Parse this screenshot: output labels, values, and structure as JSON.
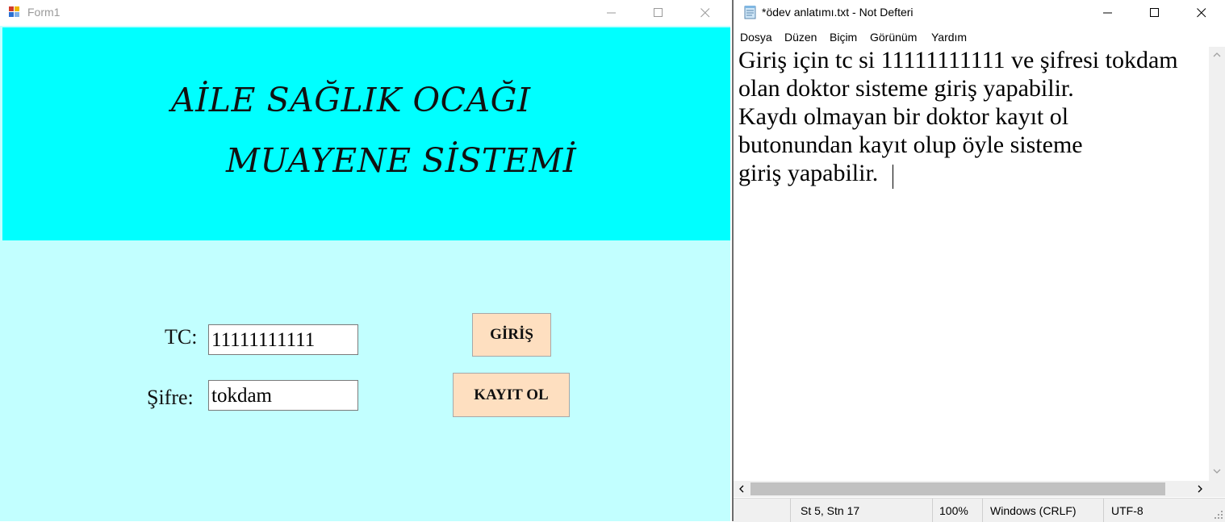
{
  "form1": {
    "title": "Form1",
    "heading_line1": "AİLE SAĞLIK OCAĞI",
    "heading_line2": "MUAYENE SİSTEMİ",
    "tc_label": "TC:",
    "tc_value": "11111111111",
    "sifre_label": "Şifre:",
    "sifre_value": "tokdam",
    "giris_button": "GİRİŞ",
    "kayit_button": "KAYIT OL",
    "colors": {
      "banner": "#00ffff",
      "body": "#c2ffff",
      "button": "#fedfc0"
    }
  },
  "notepad": {
    "title": "*ödev anlatımı.txt - Not Defteri",
    "menu": [
      "Dosya",
      "Düzen",
      "Biçim",
      "Görünüm",
      "Yardım"
    ],
    "lines": [
      "Giriş için tc si 11111111111 ve şifresi tokdam",
      "olan doktor sisteme giriş yapabilir.",
      "Kaydı olmayan bir doktor kayıt ol",
      "butonundan kayıt olup öyle sisteme",
      "giriş yapabilir."
    ],
    "status": {
      "position": "St 5, Stn 17",
      "zoom": "100%",
      "line_ending": "Windows (CRLF)",
      "encoding": "UTF-8"
    }
  },
  "icons": [
    "form-app-icon",
    "minimize-icon",
    "maximize-icon",
    "close-icon",
    "notepad-icon",
    "scroll-up-icon",
    "scroll-down-icon",
    "scroll-left-icon",
    "scroll-right-icon",
    "resize-grip-icon"
  ]
}
